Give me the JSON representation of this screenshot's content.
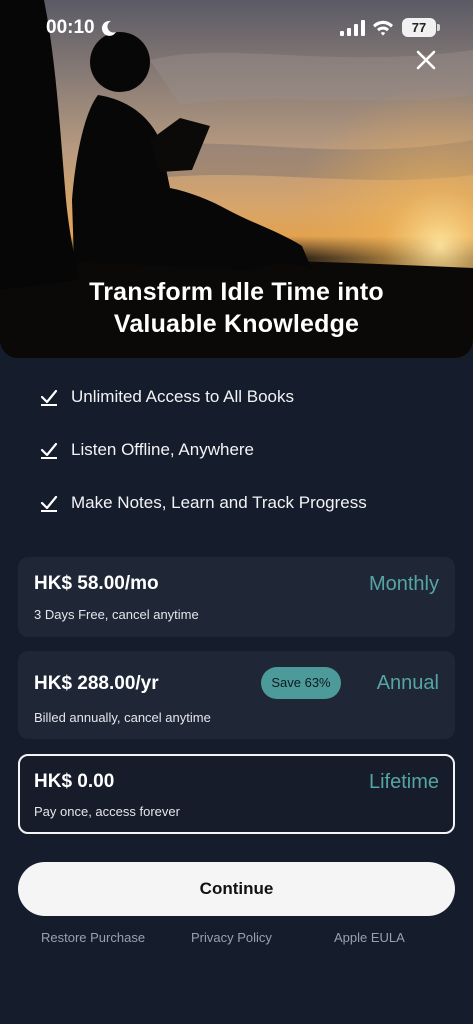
{
  "status_bar": {
    "time": "00:10",
    "battery": "77"
  },
  "hero": {
    "title_line1": "Transform Idle Time into",
    "title_line2": "Valuable Knowledge"
  },
  "features": [
    {
      "label": "Unlimited Access to All Books"
    },
    {
      "label": "Listen Offline, Anywhere"
    },
    {
      "label": "Make Notes, Learn and Track Progress"
    }
  ],
  "plans": [
    {
      "price": "HK$ 58.00/mo",
      "subtitle": "3 Days Free, cancel anytime",
      "name": "Monthly",
      "selected": false
    },
    {
      "price": "HK$ 288.00/yr",
      "subtitle": "Billed annually, cancel anytime",
      "name": "Annual",
      "badge": "Save 63%",
      "selected": false
    },
    {
      "price": "HK$ 0.00",
      "subtitle": "Pay once, access forever",
      "name": "Lifetime",
      "selected": true
    }
  ],
  "continue_label": "Continue",
  "footer": {
    "restore": "Restore Purchase",
    "privacy": "Privacy Policy",
    "eula": "Apple EULA"
  },
  "colors": {
    "background": "#151c2b",
    "card": "#1f2737",
    "accent_teal": "#56a5a3",
    "badge": "#4c9a99"
  },
  "icons": [
    "moon-icon",
    "signal-icon",
    "wifi-icon",
    "battery-icon",
    "close-icon",
    "check-icon"
  ]
}
